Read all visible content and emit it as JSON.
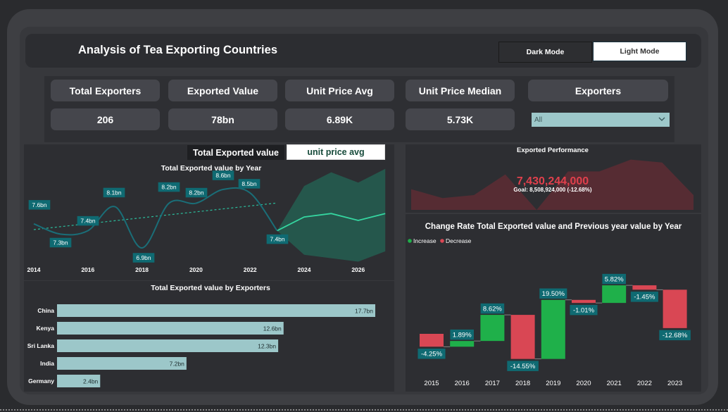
{
  "header": {
    "title": "Analysis of Tea Exporting Countries",
    "dark_mode_label": "Dark Mode",
    "light_mode_label": "Light Mode"
  },
  "kpis": [
    {
      "label": "Total Exporters",
      "value": "206"
    },
    {
      "label": "Exported Value",
      "value": "78bn"
    },
    {
      "label": "Unit Price Avg",
      "value": "6.89K"
    },
    {
      "label": "Unit Price Median",
      "value": "5.73K"
    }
  ],
  "filter": {
    "label": "Exporters",
    "selected": "All",
    "icon": "chevron-down-icon"
  },
  "toggle": {
    "option_a": "Total Exported value",
    "option_b": "unit price avg"
  },
  "colors": {
    "teal_line": "#1a6e78",
    "label_bg": "#0f6a72",
    "forecast": "#1f7a62",
    "forecast_line": "#35d6a0",
    "bar": "#9cc7c9",
    "increase": "#1fb04a",
    "decrease": "#d94754",
    "goal_text": "#e0404c"
  },
  "chart_data": [
    {
      "type": "line",
      "title": "Total Exported value by Year",
      "x": [
        2014,
        2015,
        2016,
        2017,
        2018,
        2019,
        2020,
        2021,
        2022,
        2023
      ],
      "series": [
        {
          "values": [
            7.6,
            7.3,
            7.4,
            8.1,
            6.9,
            8.2,
            8.2,
            8.6,
            8.5,
            7.4
          ]
        }
      ],
      "data_labels": [
        "7.6bn",
        "7.3bn",
        "7.4bn",
        "8.1bn",
        "6.9bn",
        "8.2bn",
        "8.2bn",
        "8.6bn",
        "8.5bn",
        "7.4bn"
      ],
      "x_ticks": [
        "2014",
        "2016",
        "2018",
        "2020",
        "2022",
        "2024",
        "2026"
      ],
      "forecast": {
        "x": [
          2023,
          2024,
          2025,
          2026,
          2027
        ],
        "values": [
          7.4,
          7.8,
          7.9,
          7.7,
          7.9
        ],
        "lower": [
          7.4,
          6.7,
          6.6,
          6.5,
          6.8
        ],
        "upper": [
          7.4,
          8.7,
          9.1,
          8.8,
          9.2
        ]
      },
      "trend": true
    },
    {
      "type": "bar",
      "orientation": "horizontal",
      "title": "Total Exported value by Exporters",
      "categories": [
        "China",
        "Kenya",
        "Sri Lanka",
        "India",
        "Germany"
      ],
      "values": [
        17.7,
        12.6,
        12.3,
        7.2,
        2.4
      ],
      "data_labels": [
        "17.7bn",
        "12.6bn",
        "12.3bn",
        "7.2bn",
        "2.4bn"
      ]
    },
    {
      "type": "area",
      "title": "Exported Performance",
      "value": "7,430,244,000",
      "goal_text": "Goal: 8,508,924,000 (-12.68%)",
      "x": [
        2014,
        2015,
        2016,
        2017,
        2018,
        2019,
        2020,
        2021,
        2022,
        2023
      ],
      "values": [
        7.6,
        7.3,
        7.4,
        8.1,
        6.9,
        8.2,
        8.2,
        8.6,
        8.5,
        7.4
      ]
    },
    {
      "type": "bar",
      "subtype": "waterfall",
      "title": "Change Rate Total Exported value and Previous year value by Year",
      "legend": [
        "Increase",
        "Decrease"
      ],
      "categories": [
        "2015",
        "2016",
        "2017",
        "2018",
        "2019",
        "2020",
        "2021",
        "2022",
        "2023"
      ],
      "values": [
        -4.25,
        1.89,
        8.62,
        -14.55,
        19.5,
        -1.01,
        5.82,
        -1.45,
        -12.68
      ],
      "data_labels": [
        "-4.25%",
        "1.89%",
        "8.62%",
        "-14.55%",
        "19.50%",
        "-1.01%",
        "5.82%",
        "-1.45%",
        "-12.68%"
      ]
    }
  ]
}
